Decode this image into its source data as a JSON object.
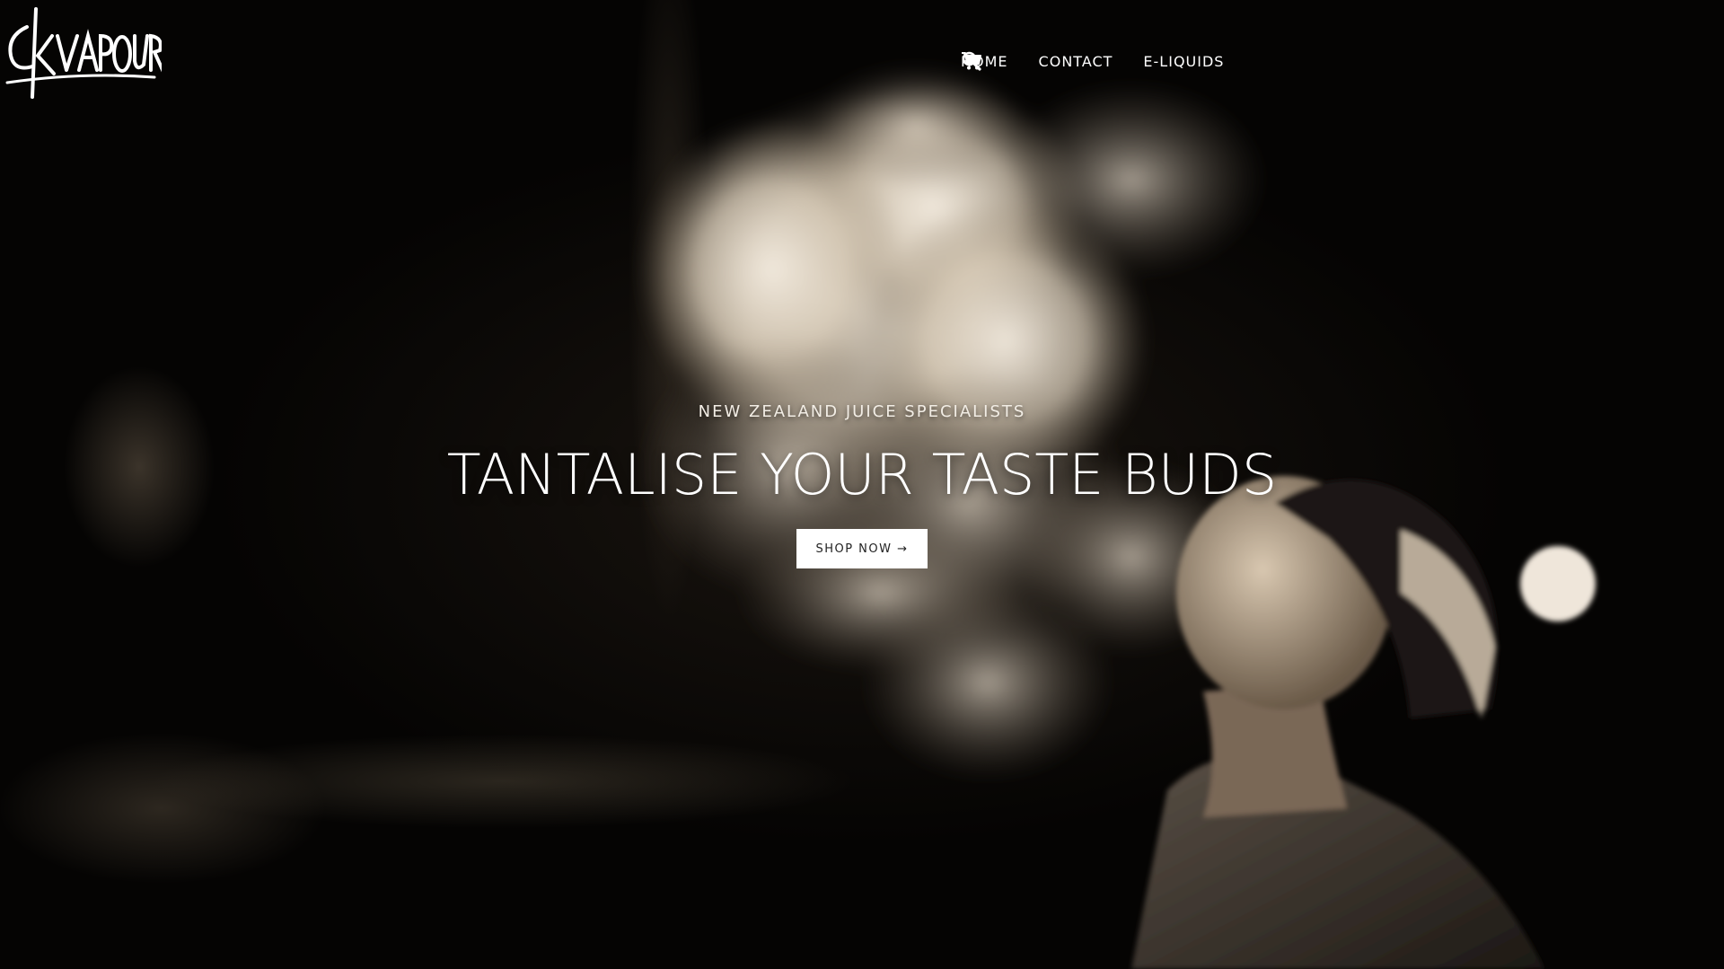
{
  "brand": {
    "logo_text": "CKVAPOUR"
  },
  "nav": {
    "items": [
      {
        "label": "HOME"
      },
      {
        "label": "CONTACT"
      },
      {
        "label": "E-LIQUIDS"
      }
    ],
    "search_icon": "search-icon",
    "cart_icon": "cart-icon"
  },
  "hero": {
    "kicker": "NEW ZEALAND JUICE SPECIALISTS",
    "headline": "TANTALISE YOUR TASTE BUDS",
    "cta_label": "SHOP NOW →",
    "image_subject": "man exhaling vapour cloud, black-and-white photo"
  },
  "colors": {
    "text": "#ffffff",
    "button_bg": "#ffffff",
    "button_text": "#222222",
    "background": "#0a0806"
  }
}
